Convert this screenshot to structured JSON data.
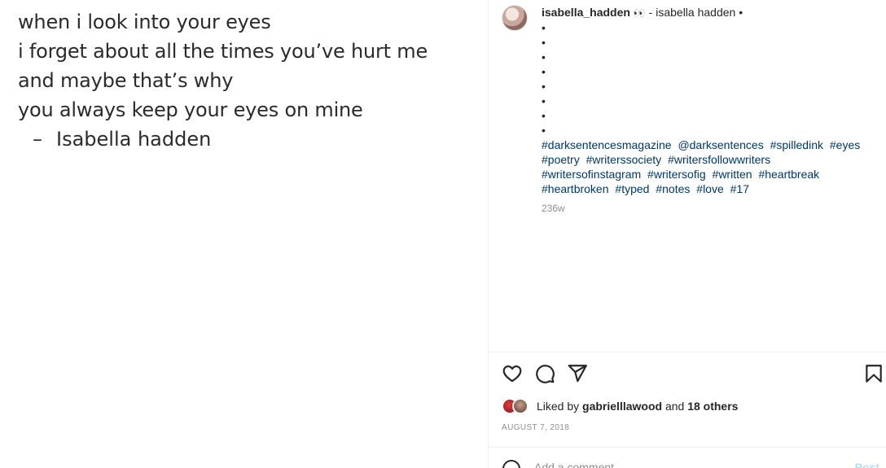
{
  "post_image": {
    "lines": [
      "when i look into your eyes",
      "i forget about all the times you’ve hurt me",
      "and maybe that’s why",
      "you always keep your eyes on mine"
    ],
    "signature_dash": "–",
    "signature": "Isabella hadden"
  },
  "caption": {
    "username": "isabella_hadden",
    "emoji": "👀",
    "text": " - isabella hadden •",
    "bullets": [
      "•",
      "•",
      "•",
      "•",
      "•",
      "•",
      "•",
      "•"
    ],
    "hashtags": [
      "#darksentencesmagazine",
      "@darksentences",
      "#spilledink",
      "#eyes",
      "#poetry",
      "#writerssociety",
      "#writersfollowwriters",
      "#writersofinstagram",
      "#writersofig",
      "#written",
      "#heartbreak",
      "#heartbroken",
      "#typed",
      "#notes",
      "#love",
      "#17"
    ],
    "time_ago": "236w"
  },
  "actions": {
    "like_icon": "heart-icon",
    "comment_icon": "comment-bubble-icon",
    "share_icon": "paper-plane-icon",
    "save_icon": "bookmark-icon"
  },
  "likes": {
    "prefix": "Liked by ",
    "user": "gabrielllawood",
    "middle": " and ",
    "others": "18 others"
  },
  "date": "August 7, 2018",
  "comment": {
    "placeholder": "Add a comment…",
    "post_label": "Post"
  },
  "colors": {
    "hashtag": "#00376b",
    "secondary_text": "#8e8e8e",
    "post_button_disabled": "#b2dffc"
  }
}
